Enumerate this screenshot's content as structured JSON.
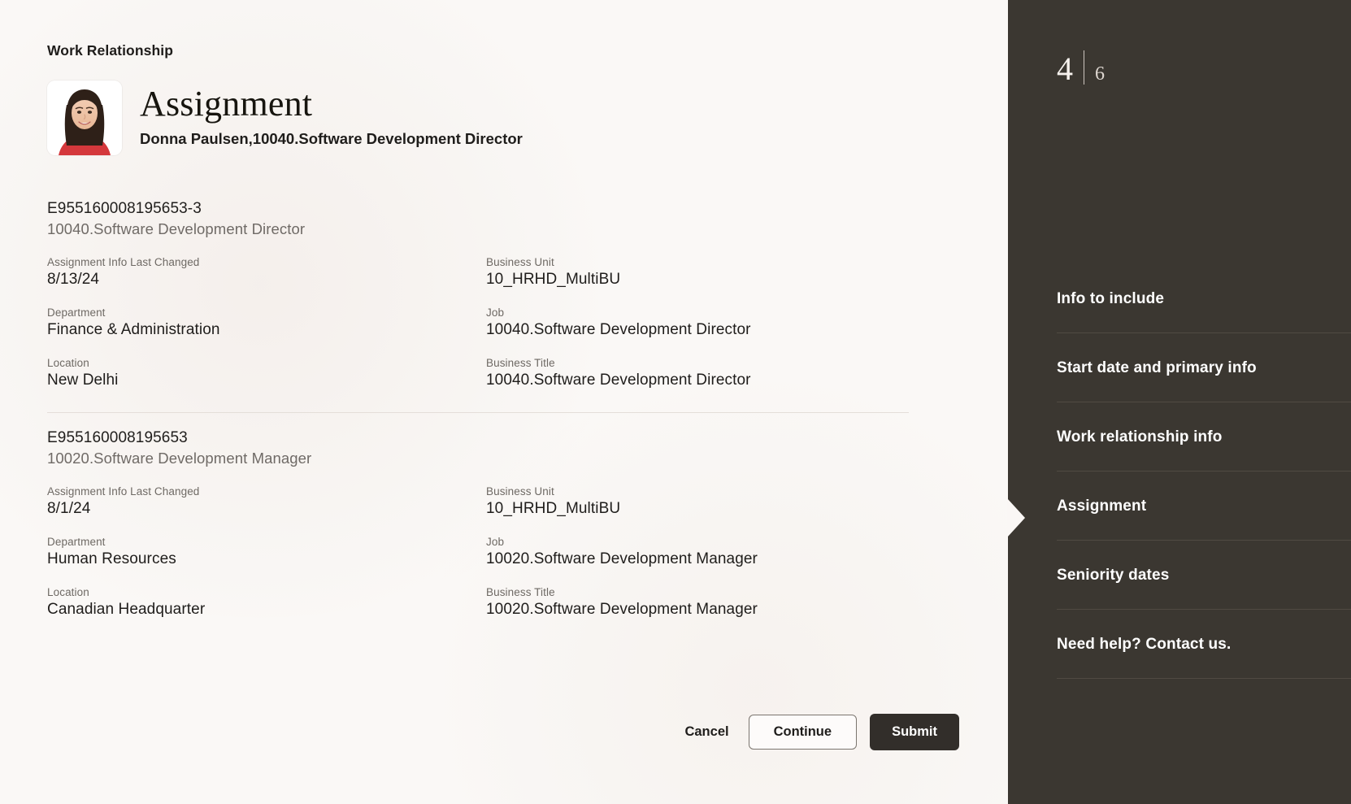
{
  "header": {
    "eyebrow": "Work Relationship",
    "title": "Assignment",
    "person_line": "Donna Paulsen,10040.Software Development Director",
    "avatar_alt": "avatar-photo"
  },
  "assignments": [
    {
      "id": "E955160008195653-3",
      "role": "10040.Software Development Director",
      "fields": [
        {
          "label": "Assignment Info Last Changed",
          "value": "8/13/24"
        },
        {
          "label": "Business Unit",
          "value": "10_HRHD_MultiBU"
        },
        {
          "label": "Department",
          "value": "Finance & Administration"
        },
        {
          "label": "Job",
          "value": "10040.Software Development Director"
        },
        {
          "label": "Location",
          "value": "New Delhi"
        },
        {
          "label": "Business Title",
          "value": "10040.Software Development Director"
        }
      ]
    },
    {
      "id": "E955160008195653",
      "role": "10020.Software Development Manager",
      "fields": [
        {
          "label": "Assignment Info Last Changed",
          "value": "8/1/24"
        },
        {
          "label": "Business Unit",
          "value": "10_HRHD_MultiBU"
        },
        {
          "label": "Department",
          "value": "Human Resources"
        },
        {
          "label": "Job",
          "value": "10020.Software Development Manager"
        },
        {
          "label": "Location",
          "value": "Canadian Headquarter"
        },
        {
          "label": "Business Title",
          "value": "10020.Software Development Manager"
        }
      ]
    }
  ],
  "actions": {
    "cancel": "Cancel",
    "continue": "Continue",
    "submit": "Submit"
  },
  "sidebar": {
    "step_current": "4",
    "step_total": "6",
    "items": [
      {
        "label": "Info to include",
        "active": false
      },
      {
        "label": "Start date and primary info",
        "active": false
      },
      {
        "label": "Work relationship info",
        "active": false
      },
      {
        "label": "Assignment",
        "active": true
      },
      {
        "label": "Seniority dates",
        "active": false
      },
      {
        "label": "Need help? Contact us.",
        "active": false
      }
    ]
  },
  "colors": {
    "page_background": "#faf8f6",
    "sidebar_background": "#3b3731",
    "primary_button": "#322e2a",
    "text_primary": "#1f1d1b",
    "text_muted": "#6e6964",
    "divider": "#e4ded9"
  }
}
